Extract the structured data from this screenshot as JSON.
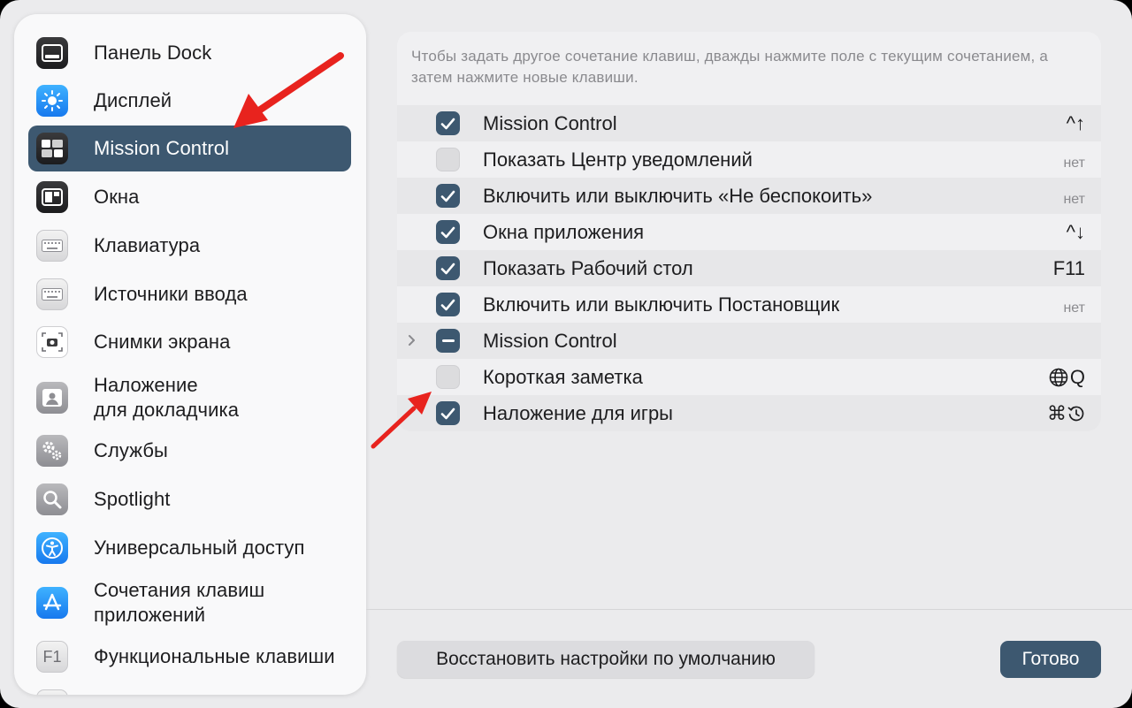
{
  "colors": {
    "accent": "#3d5870",
    "annotation_arrow": "#e8231e"
  },
  "sidebar": {
    "items": [
      {
        "label": "Панель Dock",
        "icon": "dock-icon"
      },
      {
        "label": "Дисплей",
        "icon": "display-brightness-icon"
      },
      {
        "label": "Mission Control",
        "icon": "mission-control-icon",
        "selected": true
      },
      {
        "label": "Окна",
        "icon": "windows-icon"
      },
      {
        "label": "Клавиатура",
        "icon": "keyboard-icon"
      },
      {
        "label": "Источники ввода",
        "icon": "input-sources-icon"
      },
      {
        "label": "Снимки экрана",
        "icon": "screenshot-camera-icon"
      },
      {
        "label": "Наложение\nдля докладчика",
        "icon": "presenter-overlay-icon"
      },
      {
        "label": "Службы",
        "icon": "services-gears-icon"
      },
      {
        "label": "Spotlight",
        "icon": "spotlight-magnifier-icon"
      },
      {
        "label": "Универсальный доступ",
        "icon": "accessibility-icon"
      },
      {
        "label": "Сочетания клавиш\nприложений",
        "icon": "app-store-icon"
      },
      {
        "label": "Функциональные клавиши",
        "icon": "function-keys-icon",
        "icon_text": "F1"
      }
    ]
  },
  "main": {
    "info_text": "Чтобы задать другое сочетание клавиш, дважды нажмите поле с текущим сочетанием, а затем нажмите новые клавиши.",
    "shortcuts": [
      {
        "label": "Mission Control",
        "checked": "on",
        "key": "^↑"
      },
      {
        "label": "Показать Центр уведомлений",
        "checked": "off",
        "key": "нет"
      },
      {
        "label": "Включить или выключить «Не беспокоить»",
        "checked": "on",
        "key": "нет"
      },
      {
        "label": "Окна приложения",
        "checked": "on",
        "key": "^↓"
      },
      {
        "label": "Показать Рабочий стол",
        "checked": "on",
        "key": "F11"
      },
      {
        "label": "Включить или выключить Постановщик",
        "checked": "on",
        "key": "нет"
      },
      {
        "label": "Mission Control",
        "checked": "mixed",
        "key": "",
        "disclosure": true
      },
      {
        "label": "Короткая заметка",
        "checked": "off",
        "key": "Q",
        "key_icon": "globe-icon"
      },
      {
        "label": "Наложение для игры",
        "checked": "on",
        "key": "⌘",
        "key_icon": "history-clock-icon"
      }
    ]
  },
  "footer": {
    "reset_label": "Восстановить настройки по умолчанию",
    "done_label": "Готово"
  }
}
